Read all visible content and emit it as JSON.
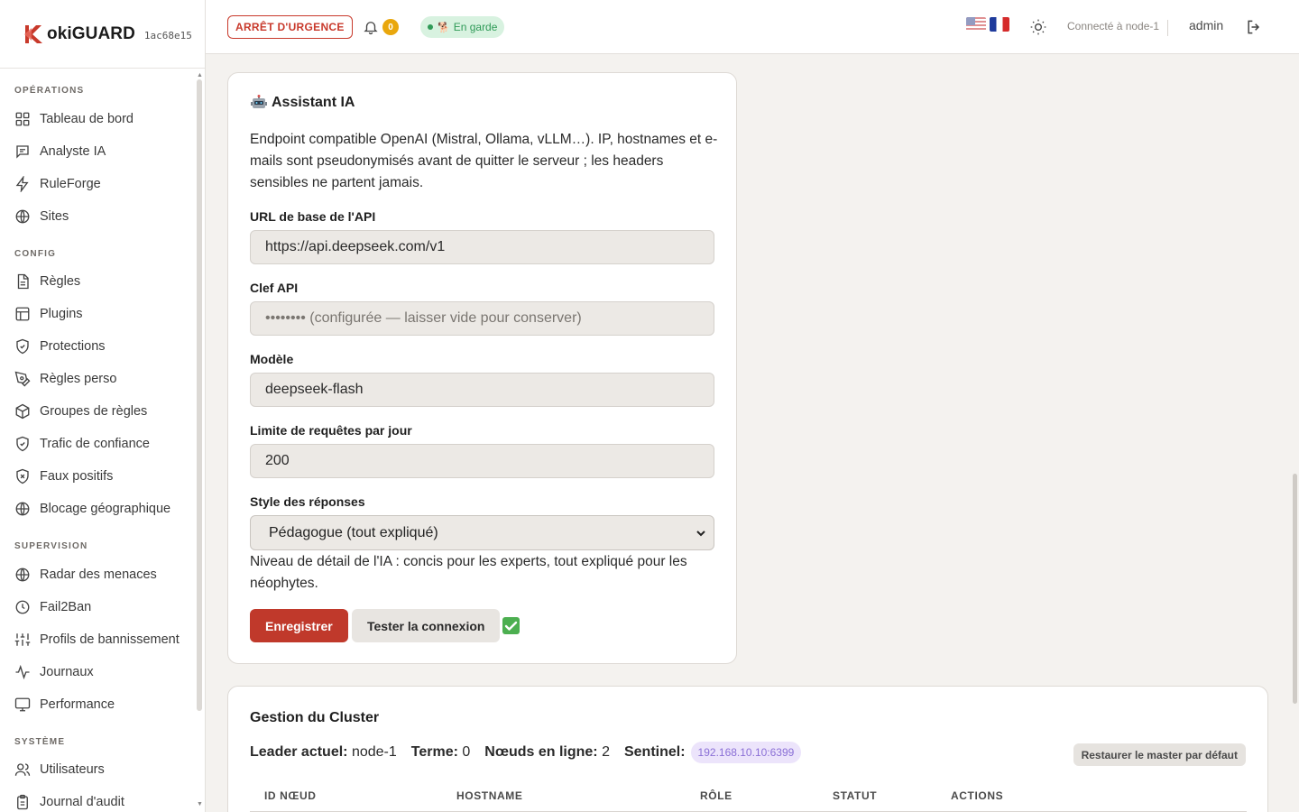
{
  "brand": {
    "name": "okiGUARD",
    "hash": "1ac68e15",
    "accent": "#c8392b"
  },
  "sidebar": {
    "sections": [
      {
        "title": "OPÉRATIONS",
        "items": [
          {
            "label": "Tableau de bord",
            "icon": "grid-icon"
          },
          {
            "label": "Analyste IA",
            "icon": "chat-icon"
          },
          {
            "label": "RuleForge",
            "icon": "bolt-icon"
          },
          {
            "label": "Sites",
            "icon": "globe-icon"
          }
        ]
      },
      {
        "title": "CONFIG",
        "items": [
          {
            "label": "Règles",
            "icon": "file-icon"
          },
          {
            "label": "Plugins",
            "icon": "layout-icon"
          },
          {
            "label": "Protections",
            "icon": "shield-check-icon"
          },
          {
            "label": "Règles perso",
            "icon": "pen-tool-icon"
          },
          {
            "label": "Groupes de règles",
            "icon": "package-icon"
          },
          {
            "label": "Trafic de confiance",
            "icon": "shield-check-icon"
          },
          {
            "label": "Faux positifs",
            "icon": "shield-x-icon"
          },
          {
            "label": "Blocage géographique",
            "icon": "globe-icon"
          }
        ]
      },
      {
        "title": "SUPERVISION",
        "items": [
          {
            "label": "Radar des menaces",
            "icon": "globe-icon"
          },
          {
            "label": "Fail2Ban",
            "icon": "clock-icon"
          },
          {
            "label": "Profils de bannissement",
            "icon": "sliders-icon"
          },
          {
            "label": "Journaux",
            "icon": "activity-icon"
          },
          {
            "label": "Performance",
            "icon": "monitor-icon"
          }
        ]
      },
      {
        "title": "SYSTÈME",
        "items": [
          {
            "label": "Utilisateurs",
            "icon": "users-icon"
          },
          {
            "label": "Journal d'audit",
            "icon": "clipboard-icon"
          }
        ]
      }
    ]
  },
  "header": {
    "emergency_label": "ARRÊT D'URGENCE",
    "notifications_count": "0",
    "guard_label": "En garde",
    "connected_label": "Connecté à node-1",
    "user": "admin"
  },
  "ai": {
    "title": "Assistant IA",
    "description": "Endpoint compatible OpenAI (Mistral, Ollama, vLLM…). IP, hostnames et e-mails sont pseudonymisés avant de quitter le serveur ; les headers sensibles ne partent jamais.",
    "url_label": "URL de base de l'API",
    "url_value": "https://api.deepseek.com/v1",
    "key_label": "Clef API",
    "key_placeholder": "•••••••• (configurée — laisser vide pour conserver)",
    "model_label": "Modèle",
    "model_value": "deepseek-flash",
    "limit_label": "Limite de requêtes par jour",
    "limit_value": "200",
    "style_label": "Style des réponses",
    "style_value": "Pédagogue (tout expliqué)",
    "style_help": "Niveau de détail de l'IA : concis pour les experts, tout expliqué pour les néophytes.",
    "save_label": "Enregistrer",
    "test_label": "Tester la connexion"
  },
  "cluster": {
    "title": "Gestion du Cluster",
    "leader_label": "Leader actuel:",
    "leader_value": "node-1",
    "term_label": "Terme:",
    "term_value": "0",
    "nodes_label": "Nœuds en ligne:",
    "nodes_value": "2",
    "sentinel_label": "Sentinel:",
    "sentinel_value": "192.168.10.10:6399",
    "restore_label": "Restaurer le master par défaut",
    "columns": [
      "ID NŒUD",
      "HOSTNAME",
      "RÔLE",
      "STATUT",
      "ACTIONS"
    ]
  }
}
